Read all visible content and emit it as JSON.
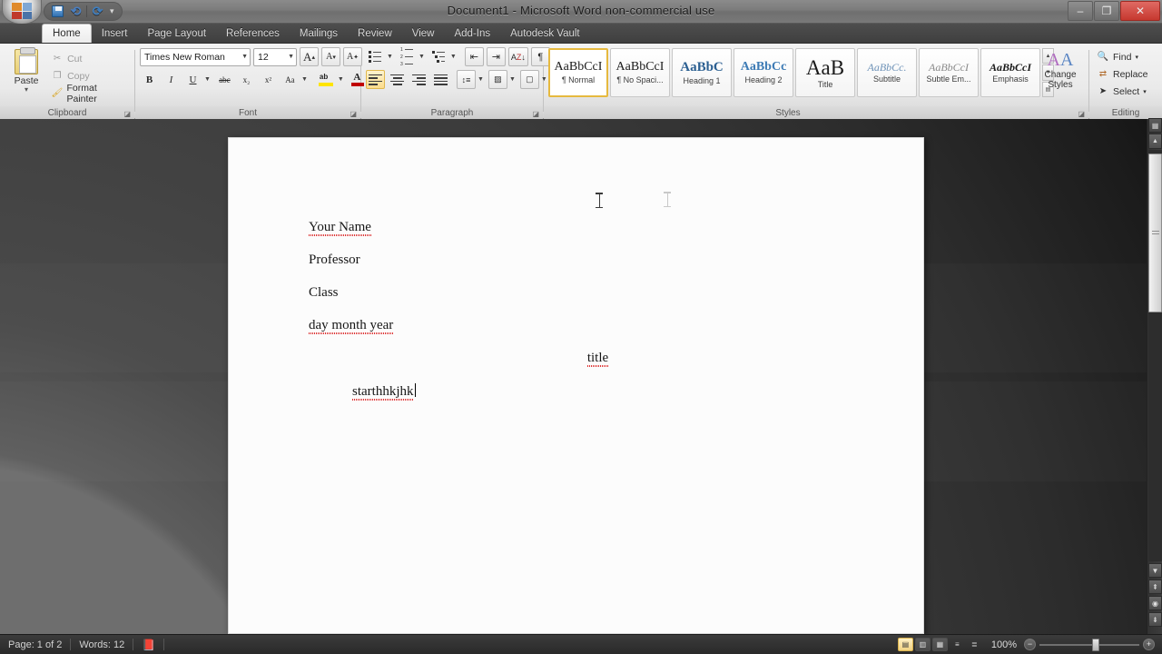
{
  "window": {
    "title": "Document1 - Microsoft Word non-commercial use",
    "minimize": "–",
    "restore": "❐",
    "close": "✕"
  },
  "quick_access": {
    "save_icon": "save-icon",
    "undo_icon": "undo-icon",
    "redo_icon": "redo-icon",
    "customize_icon": "chevron-down-icon"
  },
  "ribbon": {
    "tabs": [
      {
        "label": "Home",
        "active": true
      },
      {
        "label": "Insert",
        "active": false
      },
      {
        "label": "Page Layout",
        "active": false
      },
      {
        "label": "References",
        "active": false
      },
      {
        "label": "Mailings",
        "active": false
      },
      {
        "label": "Review",
        "active": false
      },
      {
        "label": "View",
        "active": false
      },
      {
        "label": "Add-Ins",
        "active": false
      },
      {
        "label": "Autodesk Vault",
        "active": false
      }
    ],
    "groups": {
      "clipboard": {
        "label": "Clipboard",
        "paste": "Paste",
        "cut": "Cut",
        "copy": "Copy",
        "format_painter": "Format Painter"
      },
      "font": {
        "label": "Font",
        "font_name": "Times New Roman",
        "font_size": "12",
        "grow_font": "A",
        "shrink_font": "A",
        "clear_formatting": "clear-formatting-icon",
        "bold": "B",
        "italic": "I",
        "underline": "U",
        "strikethrough": "abc",
        "subscript": "x₂",
        "superscript": "x²",
        "change_case": "Aa",
        "highlight": "ab",
        "font_color": "A"
      },
      "paragraph": {
        "label": "Paragraph",
        "bullets": "bullets-icon",
        "numbering": "numbering-icon",
        "multilevel_list": "multilevel-list-icon",
        "decrease_indent": "decrease-indent-icon",
        "increase_indent": "increase-indent-icon",
        "sort": "sort-icon",
        "show_marks": "¶",
        "align_left": "align-left-icon",
        "align_center": "align-center-icon",
        "align_right": "align-right-icon",
        "justify": "justify-icon",
        "line_spacing": "line-spacing-icon",
        "shading": "shading-icon",
        "borders": "borders-icon"
      },
      "styles": {
        "label": "Styles",
        "items": [
          {
            "preview": "AaBbCcI",
            "name": "¶ Normal",
            "selected": true
          },
          {
            "preview": "AaBbCcI",
            "name": "¶ No Spaci...",
            "selected": false
          },
          {
            "preview": "AaBbC",
            "name": "Heading 1",
            "selected": false
          },
          {
            "preview": "AaBbCc",
            "name": "Heading 2",
            "selected": false
          },
          {
            "preview": "AaB",
            "name": "Title",
            "selected": false
          },
          {
            "preview": "AaBbCc.",
            "name": "Subtitle",
            "selected": false
          },
          {
            "preview": "AaBbCcI",
            "name": "Subtle Em...",
            "selected": false
          },
          {
            "preview": "AaBbCcI",
            "name": "Emphasis",
            "selected": false
          }
        ],
        "scroll_up": "▲",
        "scroll_down": "▼",
        "more": "▤",
        "change_styles": "Change Styles"
      },
      "editing": {
        "label": "Editing",
        "find": "Find",
        "replace": "Replace",
        "select": "Select"
      }
    }
  },
  "document": {
    "paragraphs": [
      {
        "text": "Your Name",
        "align": "left",
        "indent": false,
        "misspelled": true
      },
      {
        "text": "Professor",
        "align": "left",
        "indent": false,
        "misspelled": false
      },
      {
        "text": "Class",
        "align": "left",
        "indent": false,
        "misspelled": false
      },
      {
        "text": "day month year",
        "align": "left",
        "indent": false,
        "misspelled": true
      },
      {
        "text": "title",
        "align": "center",
        "indent": false,
        "misspelled": true
      },
      {
        "text": "starthhkjhk",
        "align": "left",
        "indent": true,
        "misspelled": true,
        "caret": true
      }
    ]
  },
  "status_bar": {
    "page": "Page: 1 of 2",
    "words": "Words: 12",
    "proofing_icon": "proofing-errors-icon",
    "views": [
      {
        "name": "print-layout",
        "glyph": "▤",
        "active": true
      },
      {
        "name": "full-screen-reading",
        "glyph": "▥",
        "active": false
      },
      {
        "name": "web-layout",
        "glyph": "▦",
        "active": false
      },
      {
        "name": "outline",
        "glyph": "≡",
        "active": false
      },
      {
        "name": "draft",
        "glyph": "≣",
        "active": false
      }
    ],
    "zoom_level": "100%",
    "zoom_out": "−",
    "zoom_in": "+"
  }
}
